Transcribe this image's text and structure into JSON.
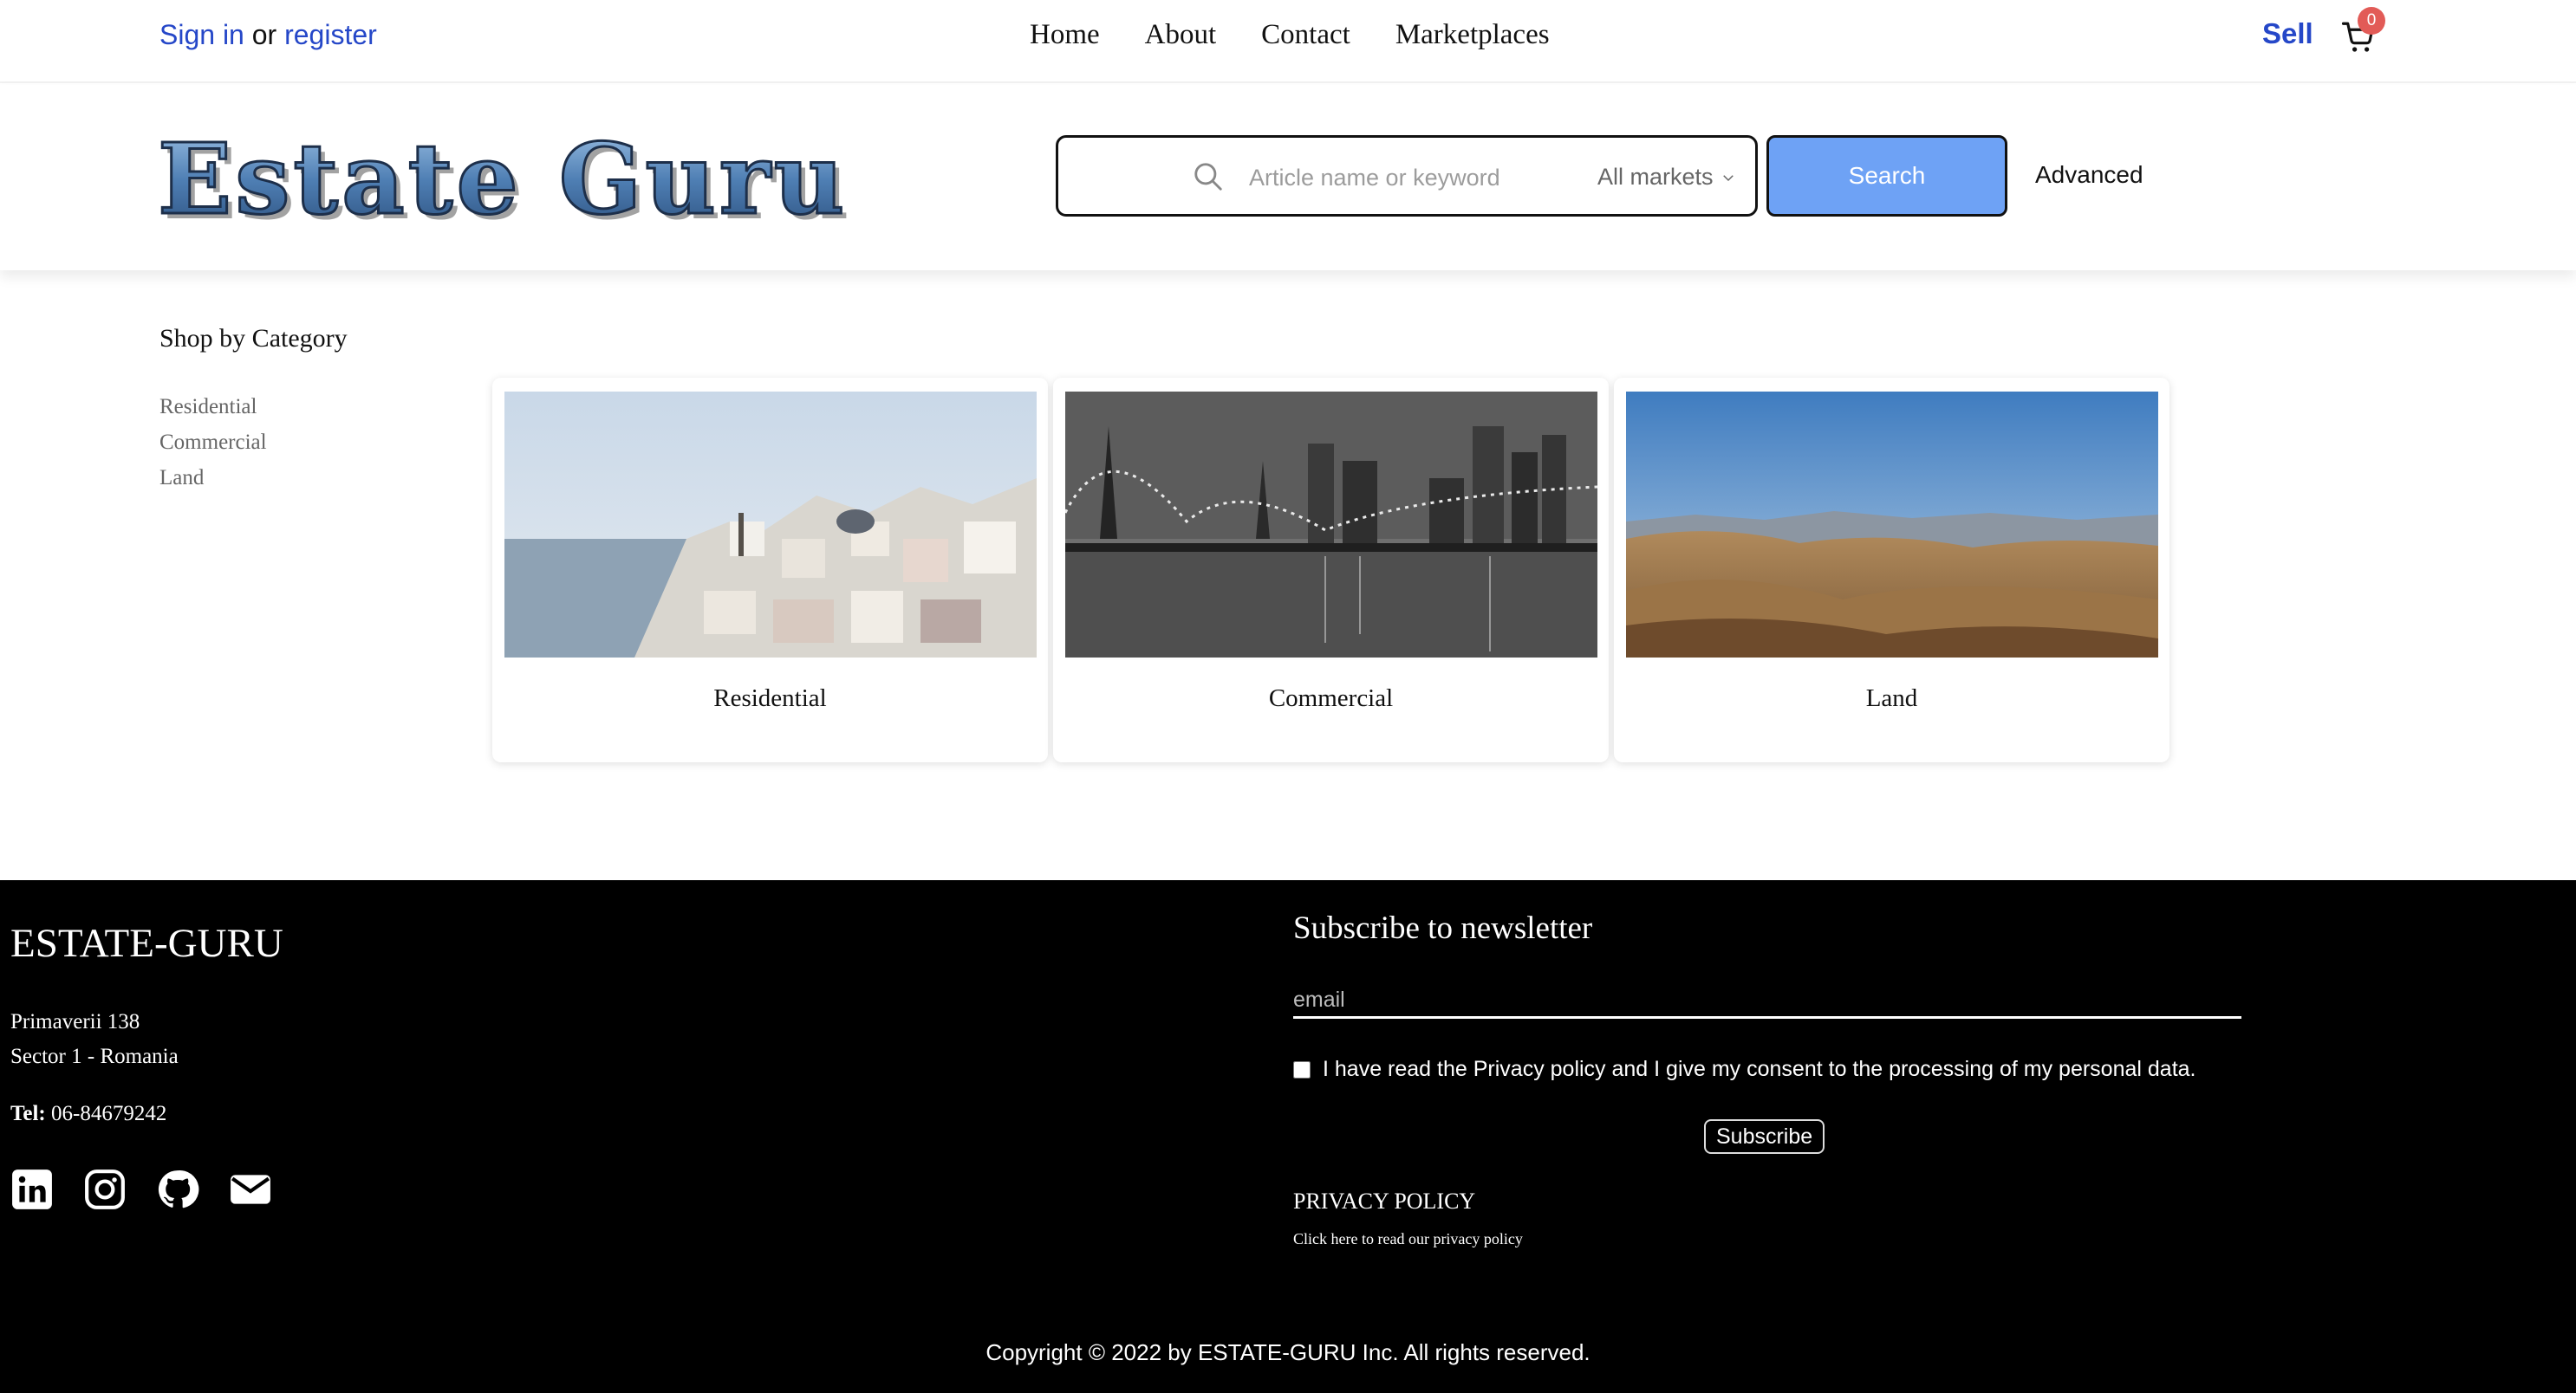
{
  "topbar": {
    "sign_in": "Sign in",
    "or": "or",
    "register": "register",
    "nav": [
      "Home",
      "About",
      "Contact",
      "Marketplaces"
    ],
    "sell": "Sell",
    "cart_count": "0",
    "cart_icon": "shopping-cart-icon"
  },
  "header": {
    "logo_text": "Estate Guru",
    "search": {
      "placeholder": "Article name or keyword",
      "market": "All markets",
      "button": "Search",
      "advanced": "Advanced"
    }
  },
  "categories": {
    "title": "Shop by Category",
    "list": [
      "Residential",
      "Commercial",
      "Land"
    ],
    "cards": [
      {
        "label": "Residential",
        "image": "santorini-village-photo"
      },
      {
        "label": "Commercial",
        "image": "city-bridge-night-photo"
      },
      {
        "label": "Land",
        "image": "rolling-hills-landscape-photo"
      }
    ]
  },
  "footer": {
    "brand": "ESTATE-GURU",
    "address_line1": "Primaverii 138",
    "address_line2": "Sector 1 - Romania",
    "tel_label": "Tel:",
    "tel_value": "06-84679242",
    "socials": [
      "linkedin-icon",
      "instagram-icon",
      "github-icon",
      "email-icon"
    ],
    "newsletter_title": "Subscribe to newsletter",
    "email_placeholder": "email",
    "consent_text": "I have read the Privacy policy and I give my consent to the processing of my personal data.",
    "subscribe_button": "Subscribe",
    "privacy_title": "PRIVACY POLICY",
    "privacy_link": "Click here to read our privacy policy",
    "copyright": "Copyright © 2022 by ESTATE-GURU Inc. All rights reserved."
  },
  "colors": {
    "link_blue": "#2547c8",
    "search_button": "#6ea2f5",
    "badge": "#e25b57",
    "footer_bg": "#000000"
  }
}
